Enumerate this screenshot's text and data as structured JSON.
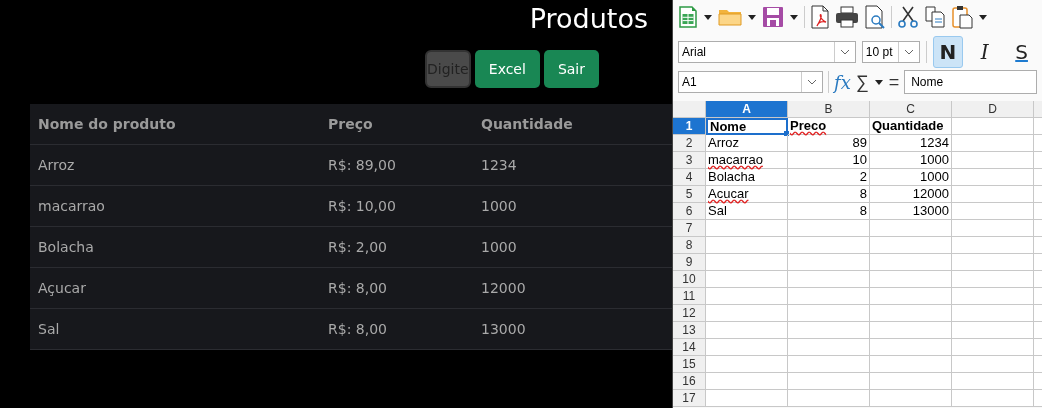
{
  "page": {
    "title": "Produtos",
    "search": {
      "placeholder": "Digite"
    },
    "buttons": [
      "Excel",
      "Sair"
    ],
    "table": {
      "columns": [
        "Nome do produto",
        "Preço",
        "Quantidade"
      ],
      "rows": [
        [
          "Arroz",
          "R$: 89,00",
          "1234"
        ],
        [
          "macarrao",
          "R$: 10,00",
          "1000"
        ],
        [
          "Bolacha",
          "R$: 2,00",
          "1000"
        ],
        [
          "Açucar",
          "R$: 8,00",
          "12000"
        ],
        [
          "Sal",
          "R$: 8,00",
          "13000"
        ]
      ]
    }
  },
  "spreadsheet": {
    "font_name": "Arial",
    "font_size": "10 pt",
    "format_buttons": [
      {
        "label": "N",
        "kind": "bold",
        "on": true
      },
      {
        "label": "I",
        "kind": "italic",
        "on": false
      },
      {
        "label": "S",
        "kind": "underline",
        "on": false
      }
    ],
    "formula_bar": {
      "name_box": "A1",
      "function_wizard": "fx",
      "sum": "∑",
      "equals": "=",
      "content": "Nome"
    },
    "column_headers": [
      {
        "label": "A",
        "selected": true
      },
      {
        "label": "B",
        "selected": false
      },
      {
        "label": "C",
        "selected": false
      },
      {
        "label": "D",
        "selected": false
      }
    ],
    "row_numbers": [
      {
        "label": "1",
        "selected": true
      },
      {
        "label": "2",
        "selected": false
      },
      {
        "label": "3",
        "selected": false
      },
      {
        "label": "4",
        "selected": false
      },
      {
        "label": "5",
        "selected": false
      },
      {
        "label": "6",
        "selected": false
      },
      {
        "label": "7",
        "selected": false
      },
      {
        "label": "8",
        "selected": false
      },
      {
        "label": "9",
        "selected": false
      },
      {
        "label": "10",
        "selected": false
      },
      {
        "label": "11",
        "selected": false
      },
      {
        "label": "12",
        "selected": false
      },
      {
        "label": "13",
        "selected": false
      },
      {
        "label": "14",
        "selected": false
      },
      {
        "label": "15",
        "selected": false
      },
      {
        "label": "16",
        "selected": false
      },
      {
        "label": "17",
        "selected": false
      }
    ],
    "rows": [
      {
        "bold": true,
        "cells": [
          {
            "text": "Nome",
            "kind": "text",
            "misspelled": false,
            "selected": true
          },
          {
            "text": "Preco",
            "kind": "text",
            "misspelled": true,
            "selected": false
          },
          {
            "text": "Quantidade",
            "kind": "text",
            "misspelled": false,
            "selected": false
          }
        ]
      },
      {
        "bold": false,
        "cells": [
          {
            "text": "Arroz",
            "kind": "text",
            "misspelled": false,
            "selected": false
          },
          {
            "text": "89",
            "kind": "number",
            "misspelled": false,
            "selected": false
          },
          {
            "text": "1234",
            "kind": "number",
            "misspelled": false,
            "selected": false
          }
        ]
      },
      {
        "bold": false,
        "cells": [
          {
            "text": "macarrao",
            "kind": "text",
            "misspelled": true,
            "selected": false
          },
          {
            "text": "10",
            "kind": "number",
            "misspelled": false,
            "selected": false
          },
          {
            "text": "1000",
            "kind": "number",
            "misspelled": false,
            "selected": false
          }
        ]
      },
      {
        "bold": false,
        "cells": [
          {
            "text": "Bolacha",
            "kind": "text",
            "misspelled": false,
            "selected": false
          },
          {
            "text": "2",
            "kind": "number",
            "misspelled": false,
            "selected": false
          },
          {
            "text": "1000",
            "kind": "number",
            "misspelled": false,
            "selected": false
          }
        ]
      },
      {
        "bold": false,
        "cells": [
          {
            "text": "Acucar",
            "kind": "text",
            "misspelled": true,
            "selected": false
          },
          {
            "text": "8",
            "kind": "number",
            "misspelled": false,
            "selected": false
          },
          {
            "text": "12000",
            "kind": "number",
            "misspelled": false,
            "selected": false
          }
        ]
      },
      {
        "bold": false,
        "cells": [
          {
            "text": "Sal",
            "kind": "text",
            "misspelled": false,
            "selected": false
          },
          {
            "text": "8",
            "kind": "number",
            "misspelled": false,
            "selected": false
          },
          {
            "text": "13000",
            "kind": "number",
            "misspelled": false,
            "selected": false
          }
        ]
      }
    ]
  }
}
